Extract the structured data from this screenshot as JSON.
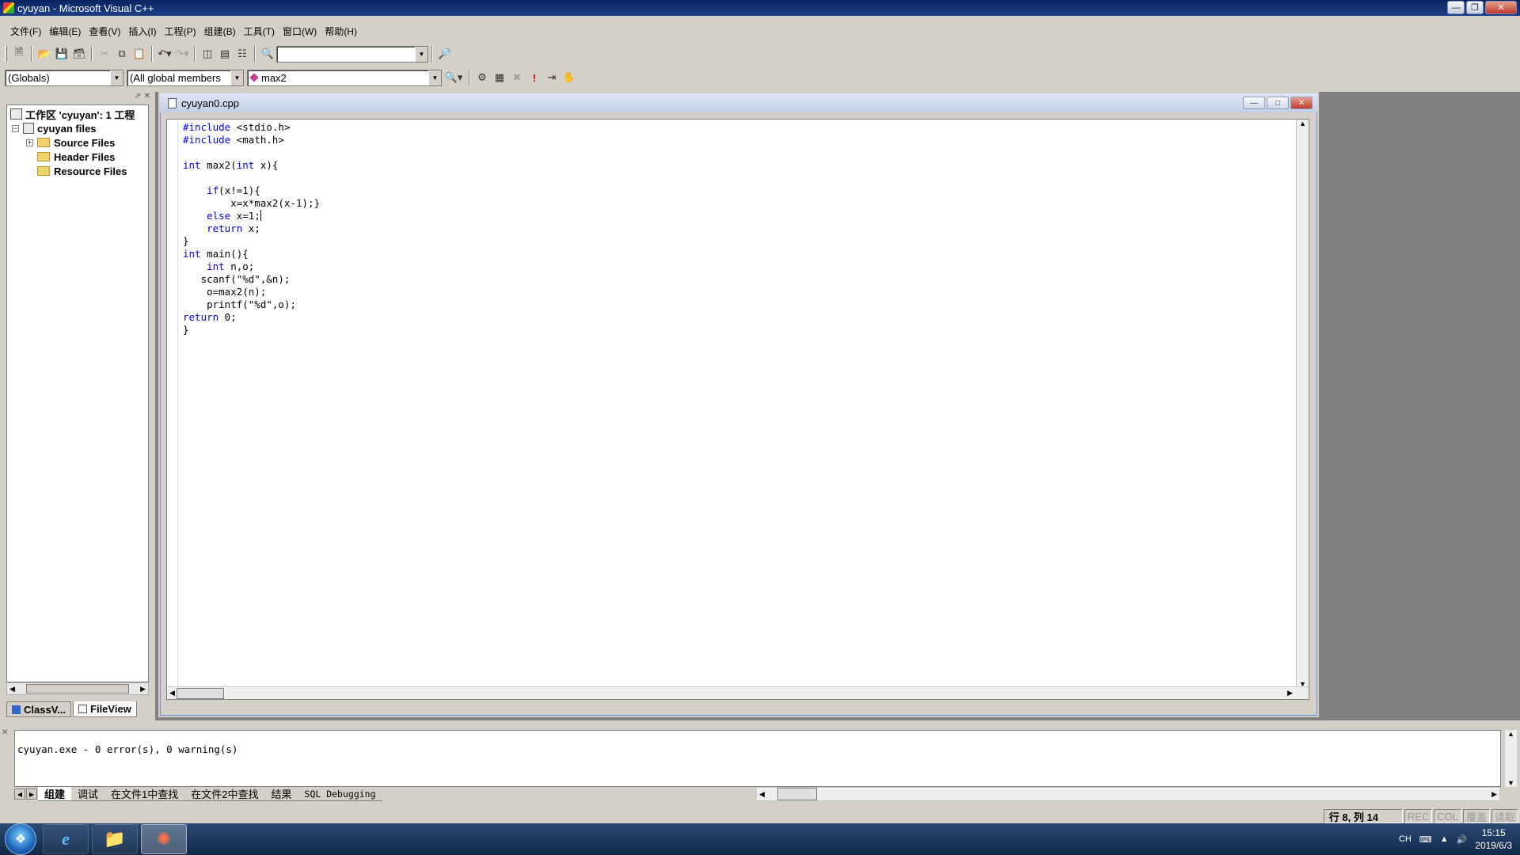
{
  "window": {
    "title": "cyuyan - Microsoft Visual C++"
  },
  "menu": [
    "文件(F)",
    "编辑(E)",
    "查看(V)",
    "插入(I)",
    "工程(P)",
    "组建(B)",
    "工具(T)",
    "窗口(W)",
    "帮助(H)"
  ],
  "wizard_bar": {
    "scope": "(Globals)",
    "filter": "(All global members",
    "member": "max2"
  },
  "workspace": {
    "root": "工作区 'cyuyan': 1 工程",
    "project": "cyuyan files",
    "folders": [
      "Source Files",
      "Header Files",
      "Resource Files"
    ],
    "tabs": [
      "ClassV...",
      "FileView"
    ]
  },
  "editor": {
    "filename": "cyuyan0.cpp",
    "lines": [
      "#include <stdio.h>",
      "#include <math.h>",
      "",
      "int max2(int x){",
      "",
      "    if(x!=1){",
      "        x=x*max2(x-1);}",
      "    else x=1;",
      "    return x;",
      "}",
      "int main(){",
      "    int n,o;",
      "   scanf(\"%d\",&n);",
      "    o=max2(n);",
      "    printf(\"%d\",o);",
      "return 0;",
      "}"
    ]
  },
  "output": {
    "text": "cyuyan.exe - 0 error(s), 0 warning(s)",
    "tabs": [
      "组建",
      "调试",
      "在文件1中查找",
      "在文件2中查找",
      "结果",
      "SQL Debugging"
    ]
  },
  "status": {
    "position": "行 8, 列 14",
    "indicators": [
      "REC",
      "COL",
      "覆盖",
      "读取"
    ]
  },
  "tray": {
    "lang": "CH",
    "time": "15:15",
    "date": "2019/6/3"
  }
}
